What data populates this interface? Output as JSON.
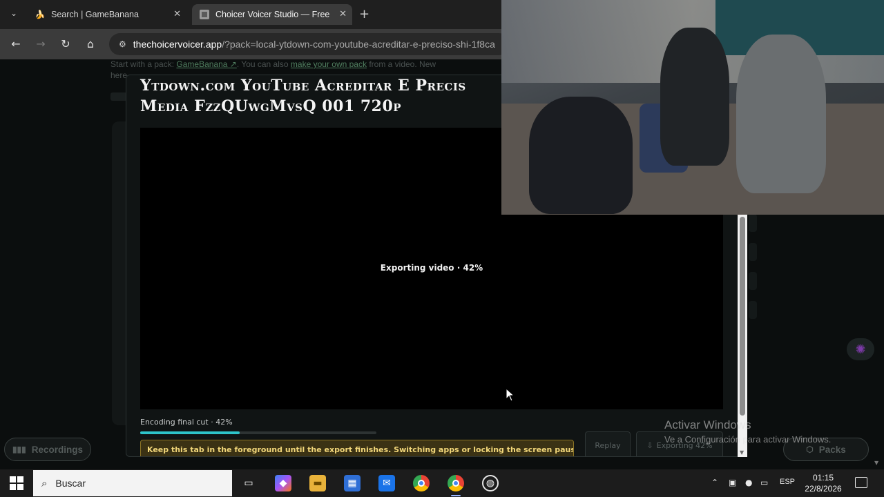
{
  "browser": {
    "tabs": [
      {
        "title": "Search | GameBanana",
        "favicon": "banana-icon",
        "active": false
      },
      {
        "title": "Choicer Voicer Studio — Free Online Voice Changer",
        "favicon": "site-icon",
        "active": true
      }
    ],
    "url_host": "thechoicervoicer.app",
    "url_rest": "/?pack=local-ytdown-com-youtube-acreditar-e-preciso-shi-1f8ca"
  },
  "page": {
    "intro_prefix": "Start with a pack",
    "intro_link": "GameBanana ↗",
    "intro_mid": ". You can also",
    "intro_link2": "make your own pack",
    "intro_suffix": "from a video. New",
    "intro_line2": "here",
    "recordings_label": "Recordings",
    "packs_label": "Packs"
  },
  "modal": {
    "title_line1": "Ytdown.com YouTube Acreditar E Precis",
    "title_line2": "Media FzzQUwgMvsQ 001 720p",
    "export_status": "Exporting video · 42%",
    "progress_label": "Encoding final cut · 42%",
    "progress": 0.42,
    "warning": "Keep this tab in the foreground until the export finishes. Switching apps or locking the screen pauses",
    "replay_label": "Replay",
    "export_label": "Exporting 42%"
  },
  "windows": {
    "activate_title": "Activar Windows",
    "activate_sub": "Ve a Configuración para activar Windows."
  },
  "taskbar": {
    "search_placeholder": "Buscar",
    "language": "ESP",
    "time": "01:15",
    "date": "22/8/2026"
  },
  "colors": {
    "accent": "#2ec4c9",
    "warning_bg": "#3b3214",
    "warning_text": "#f2d77a"
  }
}
